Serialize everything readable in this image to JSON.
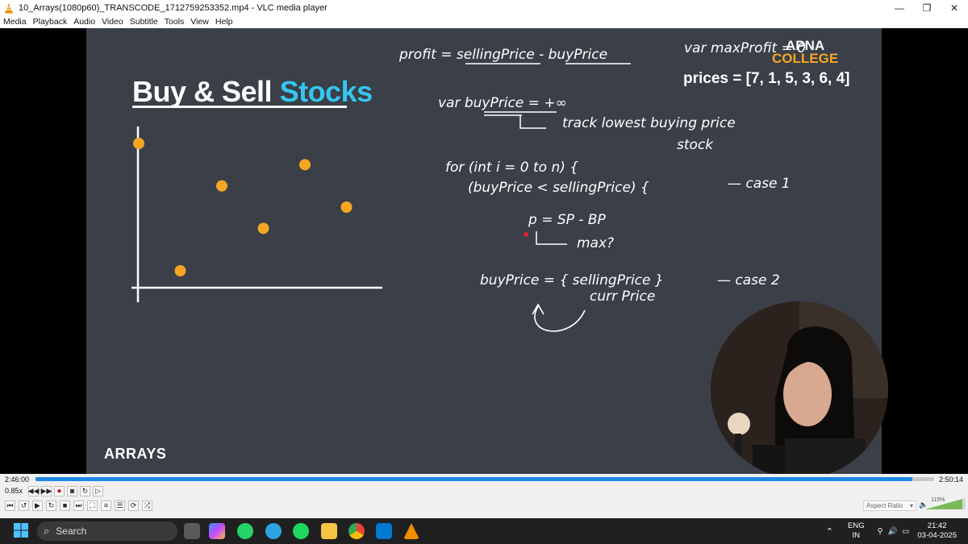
{
  "window": {
    "title": "10_Arrays(1080p60)_TRANSCODE_1712759253352.mp4 - VLC media player",
    "minimize": "—",
    "restore": "❐",
    "close": "✕"
  },
  "menubar": {
    "items": [
      "Media",
      "Playback",
      "Audio",
      "Video",
      "Subtitle",
      "Tools",
      "View",
      "Help"
    ]
  },
  "slide": {
    "title_part1": "Buy & Sell ",
    "title_part2": "Stocks",
    "prices": "prices = [7, 1, 5, 3, 6, 4]",
    "section_label": "ARRAYS",
    "logo_line1": "APNA",
    "logo_line2": "COLLEGE",
    "accent_color": "#36c5f0",
    "point_color": "#f5a623",
    "stock_points": [
      7,
      1,
      5,
      3,
      6,
      4
    ]
  },
  "handwriting": {
    "profit_formula": "profit = sellingPrice - buyPrice",
    "max_profit_var": "var maxProfit = 0",
    "buy_price_var": "var buyPrice = +∞",
    "track_note": "track lowest buying price",
    "stock_note": "stock",
    "for_loop": "for (int i = 0 to n) {",
    "case1_condition": "(buyPrice < sellingPrice) {",
    "case1_label": "— case 1",
    "profit_expr": "p = SP - BP",
    "max_note": "max?",
    "case2_assign_line1": "buyPrice = { sellingPrice }",
    "case2_assign_line2": "curr Price",
    "case2_label": "— case 2"
  },
  "player": {
    "elapsed": "2:46:00",
    "total": "2:50:14",
    "progress": 0.976,
    "speed": "0.85x",
    "aspect_ratio": "Aspect Ratio",
    "volume": "115%",
    "volume_level": 1.15
  },
  "taskbar": {
    "search_placeholder": "Search",
    "lang_line1": "ENG",
    "lang_line2": "IN",
    "time": "21:42",
    "date": "03-04-2025"
  }
}
